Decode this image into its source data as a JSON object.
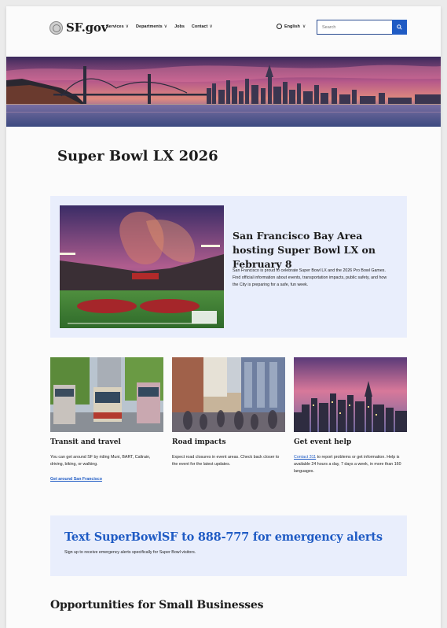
{
  "header": {
    "logo_text": "SF.gov",
    "nav": [
      {
        "label": "Services"
      },
      {
        "label": "Departments"
      },
      {
        "label": "Jobs"
      },
      {
        "label": "Contact"
      }
    ],
    "language": "English",
    "search_placeholder": "Search"
  },
  "hero": {
    "image": "san-francisco-bay-bridge-skyline-sunset"
  },
  "page_title": "Super Bowl LX 2026",
  "featured": {
    "image": "levis-stadium-super-bowl-night",
    "title": "San Francisco Bay Area hosting Super Bowl LX on February 8",
    "body": "San Francisco is proud to celebrate Super Bowl LX and the 2026 Pro Bowl Games. Find official information about events, transportation impacts, public safety, and how the City is preparing for a safe, fun week."
  },
  "cards": [
    {
      "image": "muni-streetcars",
      "title": "Transit and travel",
      "body": "You can get around SF by riding Muni, BART, Caltrain, driving, biking, or walking.",
      "link": "Get around San Francisco"
    },
    {
      "image": "crowded-city-street",
      "title": "Road impacts",
      "body": "Expect road closures in event areas. Check back closer to the event for the latest updates."
    },
    {
      "image": "san-francisco-skyline-dusk",
      "title": "Get event help",
      "link_inline": "Contact 311",
      "body_after_link": " to report problems or get information. Help is available 24 hours a day, 7 days a week, in more than 160 languages."
    }
  ],
  "alert": {
    "title": "Text SuperBowlSF to 888-777 for emergency alerts",
    "subtitle": "Sign up to receive emergency alerts specifically for Super Bowl visitors."
  },
  "next_section_title": "Opportunities for Small Businesses",
  "colors": {
    "accent": "#1f5bc4",
    "panel_bg": "#e9eefc",
    "text": "#1c1c1c"
  }
}
